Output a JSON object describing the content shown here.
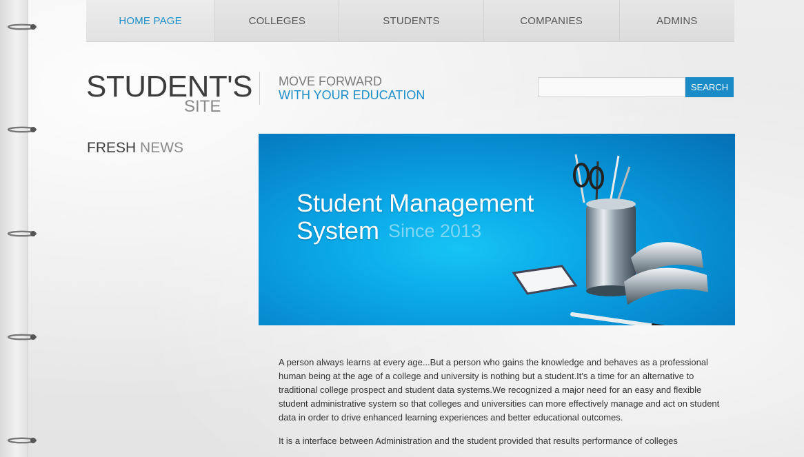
{
  "nav": {
    "items": [
      {
        "label": "HOME PAGE",
        "active": true
      },
      {
        "label": "COLLEGES",
        "active": false
      },
      {
        "label": "STUDENTS",
        "active": false
      },
      {
        "label": "COMPANIES",
        "active": false
      },
      {
        "label": "ADMINS",
        "active": false
      }
    ]
  },
  "logo": {
    "main": "STUDENT'S",
    "sub": "SITE"
  },
  "tagline": {
    "line1": "MOVE FORWARD",
    "line2": "WITH YOUR EDUCATION"
  },
  "search": {
    "placeholder": "",
    "value": "",
    "button_label": "SEARCH"
  },
  "sidebar": {
    "title_a": "FRESH",
    "title_b": "NEWS"
  },
  "banner": {
    "line1": "Student Management",
    "line2": "System",
    "line3": "Since 2013"
  },
  "content": {
    "paragraphs": [
      "A person always learns at every age...But a person who gains the knowledge and behaves as a professional human being at the age of a college and university is nothing but a student.It's a time for an alternative to traditional college prospect and student data systems.We recognized a major need for an easy and flexible student administrative system so that colleges and universities can more effectively manage and act on student data in order to drive enhanced learning experiences and better educational outcomes.",
      "It is a interface between Administration and the student provided that results performance of colleges"
    ]
  },
  "colors": {
    "accent": "#1d8ec7",
    "banner": "#0aa6e6",
    "text": "#333333"
  }
}
